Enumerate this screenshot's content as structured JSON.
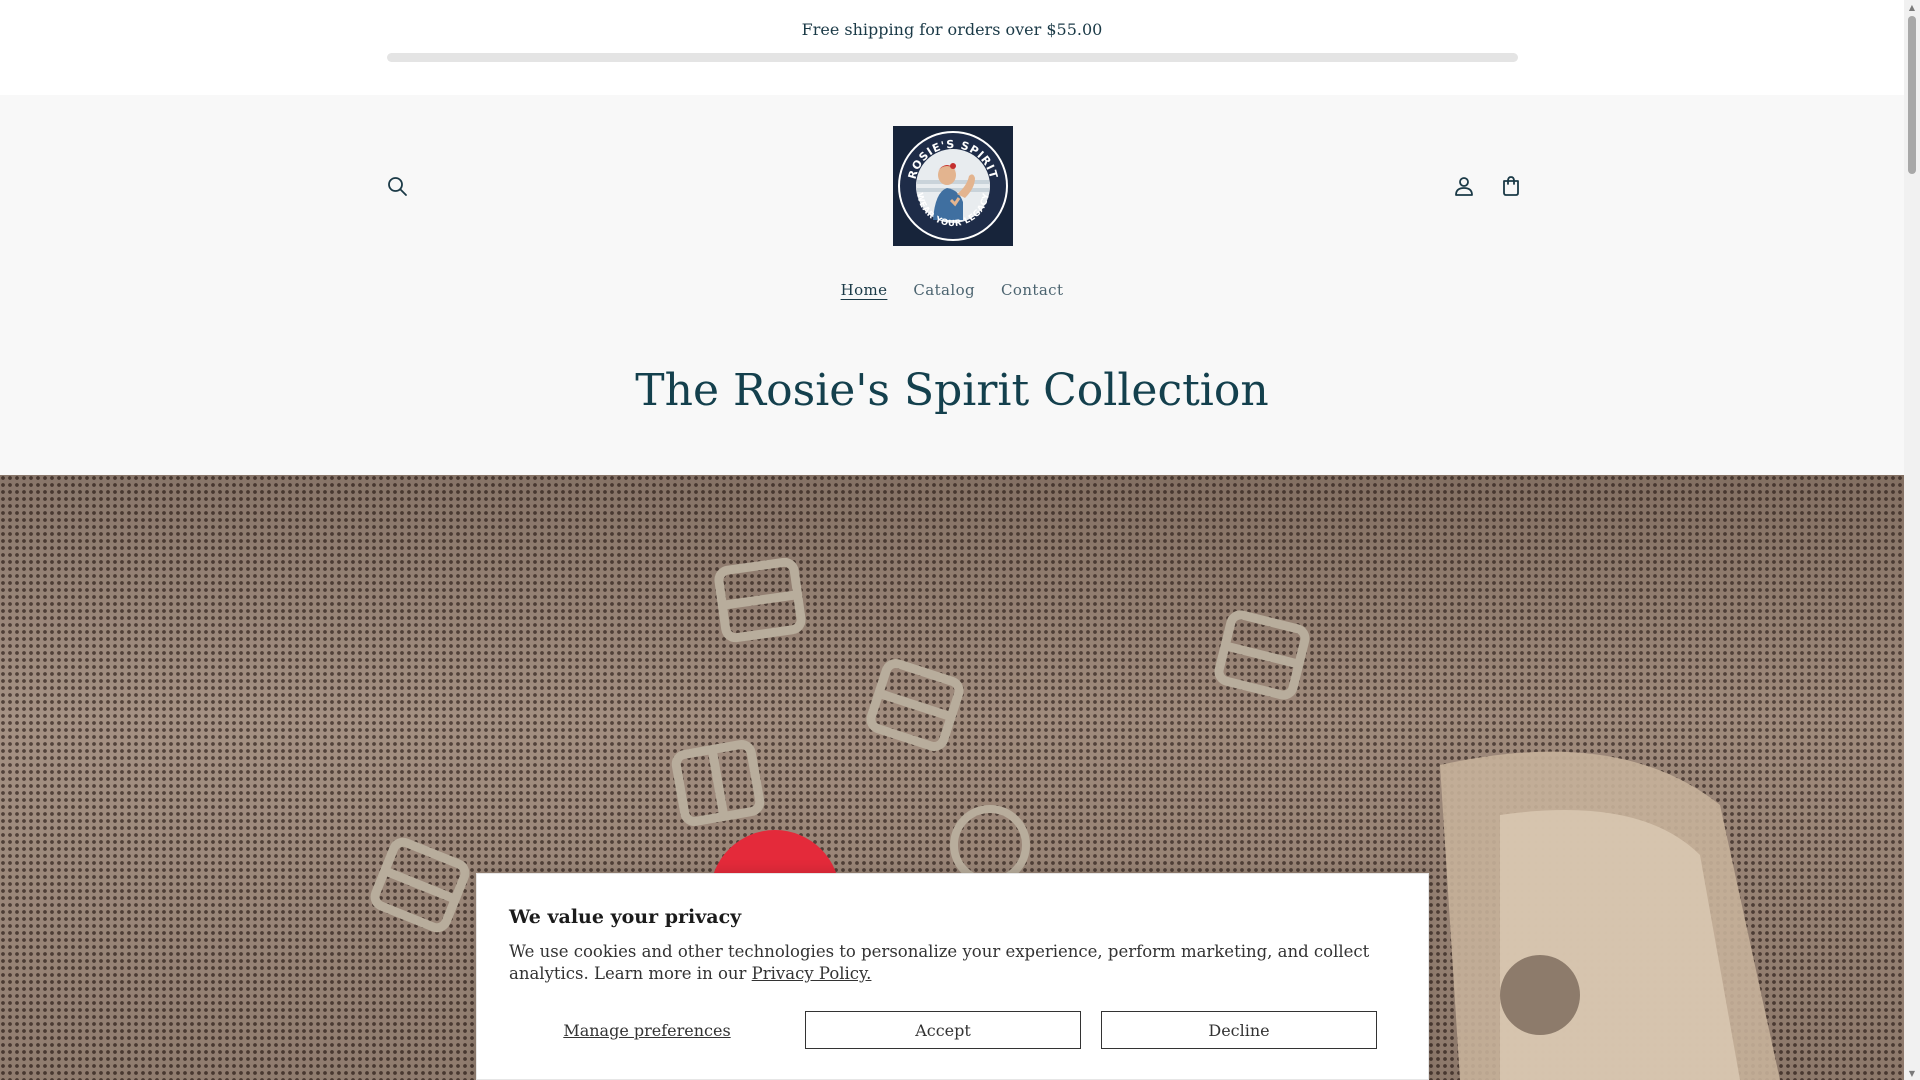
{
  "announcement": {
    "text": "Free shipping for orders over $55.00",
    "progress": 0
  },
  "header": {
    "search_icon": "search-icon",
    "account_icon": "account-icon",
    "cart_icon": "cart-icon",
    "logo": {
      "line1": "ROSIE'S SPIRIT",
      "line2": "WEAR YOUR LEGACY"
    }
  },
  "nav": {
    "items": [
      {
        "label": "Home",
        "active": true
      },
      {
        "label": "Catalog",
        "active": false
      },
      {
        "label": "Contact",
        "active": false
      }
    ]
  },
  "main": {
    "collection_title": "The Rosie's Spirit Collection"
  },
  "cookie": {
    "title": "We value your privacy",
    "text": "We use cookies and other technologies to personalize your experience, perform marketing, and collect analytics. Learn more in our",
    "policy_link": "Privacy Policy.",
    "manage_label": "Manage preferences",
    "accept_label": "Accept",
    "decline_label": "Decline"
  },
  "colors": {
    "brand_text": "#1b3a47",
    "header_bg": "#f8f8f8",
    "logo_bg": "#17243a"
  }
}
